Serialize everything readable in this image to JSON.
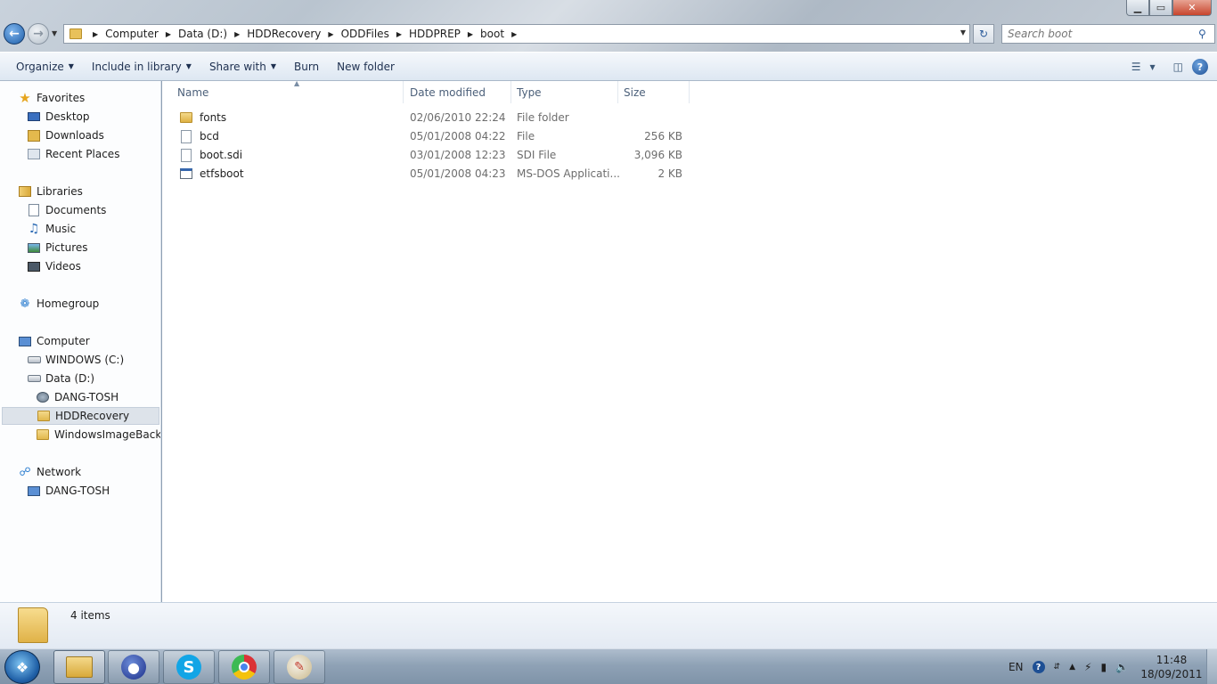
{
  "window": {
    "minimize_label": "▁",
    "maximize_label": "▭",
    "close_label": "✕"
  },
  "address": {
    "breadcrumbs": [
      "Computer",
      "Data (D:)",
      "HDDRecovery",
      "ODDFiles",
      "HDDPREP",
      "boot"
    ]
  },
  "search": {
    "placeholder": "Search boot"
  },
  "toolbar": {
    "organize": "Organize",
    "include_in_library": "Include in library",
    "share_with": "Share with",
    "burn": "Burn",
    "new_folder": "New folder",
    "help": "?"
  },
  "sidebar": {
    "favorites": {
      "label": "Favorites",
      "items": [
        "Desktop",
        "Downloads",
        "Recent Places"
      ]
    },
    "libraries": {
      "label": "Libraries",
      "items": [
        "Documents",
        "Music",
        "Pictures",
        "Videos"
      ]
    },
    "homegroup": {
      "label": "Homegroup"
    },
    "computer": {
      "label": "Computer",
      "drives": [
        "WINDOWS (C:)",
        "Data (D:)"
      ],
      "subitems": [
        "DANG-TOSH",
        "HDDRecovery",
        "WindowsImageBackup"
      ]
    },
    "network": {
      "label": "Network",
      "items": [
        "DANG-TOSH"
      ]
    }
  },
  "filelist": {
    "columns": {
      "name": "Name",
      "date": "Date modified",
      "type": "Type",
      "size": "Size"
    },
    "rows": [
      {
        "name": "fonts",
        "date": "02/06/2010 22:24",
        "type": "File folder",
        "size": "",
        "icon": "folder-icon"
      },
      {
        "name": "bcd",
        "date": "05/01/2008 04:22",
        "type": "File",
        "size": "256 KB",
        "icon": "file-icon"
      },
      {
        "name": "boot.sdi",
        "date": "03/01/2008 12:23",
        "type": "SDI File",
        "size": "3,096 KB",
        "icon": "file-icon"
      },
      {
        "name": "etfsboot",
        "date": "05/01/2008 04:23",
        "type": "MS-DOS Applicati...",
        "size": "2 KB",
        "icon": "application-icon"
      }
    ]
  },
  "details": {
    "item_count": "4 items"
  },
  "taskbar": {
    "language": "EN",
    "time": "11:48",
    "date": "18/09/2011",
    "apps": [
      "Windows Explorer",
      "User",
      "Skype",
      "Google Chrome",
      "Paint"
    ]
  },
  "colors": {
    "accent": "#1d5da8",
    "selection": "#dde3ea",
    "link_text": "#1e3050"
  }
}
